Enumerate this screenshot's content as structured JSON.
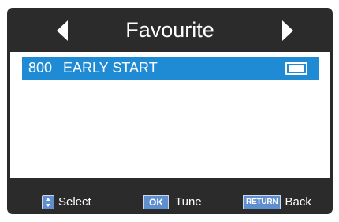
{
  "header": {
    "title": "Favourite",
    "left_icon": "left-arrow-icon",
    "right_icon": "right-arrow-icon"
  },
  "list": {
    "items": [
      {
        "number": "800",
        "name": "EARLY START",
        "icon": "tv-icon",
        "selected": true
      }
    ]
  },
  "footer": {
    "select": {
      "key_icon": "up-down-arrows-icon",
      "label": "Select"
    },
    "tune": {
      "key": "OK",
      "label": "Tune"
    },
    "back": {
      "key": "RETURN",
      "label": "Back"
    }
  },
  "colors": {
    "background": "#2b2b2b",
    "highlight": "#1f8bd4",
    "key": "#5f8fcf"
  }
}
